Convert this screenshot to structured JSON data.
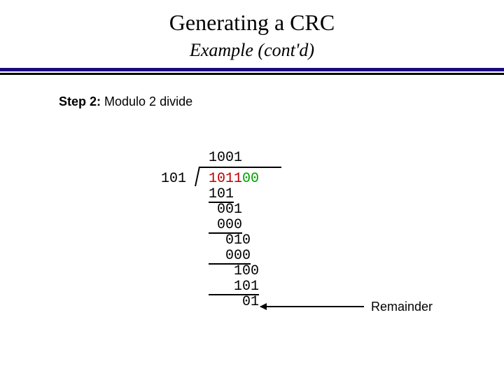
{
  "title": "Generating a CRC",
  "subtitle_a": "Example",
  "subtitle_b": "(cont'd)",
  "step_label": "Step 2:",
  "step_text": " Modulo 2 divide",
  "divisor": "101",
  "quotient": "1001",
  "dividend_dataword": "1011",
  "dividend_zeros": "00",
  "rows": {
    "r2": "101",
    "r3": " 001",
    "r4": " 000",
    "r5": "  010",
    "r6": "  000",
    "r7": "   100",
    "r8": "   101",
    "r9": "    01"
  },
  "remainder_label": "Remainder",
  "chart_data": {
    "type": "table",
    "title": "CRC modulo-2 long division",
    "divisor": "101",
    "dividend": "101100",
    "dividend_dataword": "1011",
    "dividend_appended_zeros": "00",
    "quotient": "1001",
    "remainder": "01",
    "steps": [
      {
        "partial": "101",
        "subtract": "101",
        "result": "001"
      },
      {
        "partial": "001",
        "subtract": "000",
        "result": "010"
      },
      {
        "partial": "010",
        "subtract": "000",
        "result": "100"
      },
      {
        "partial": "100",
        "subtract": "101",
        "result": "01"
      }
    ]
  }
}
